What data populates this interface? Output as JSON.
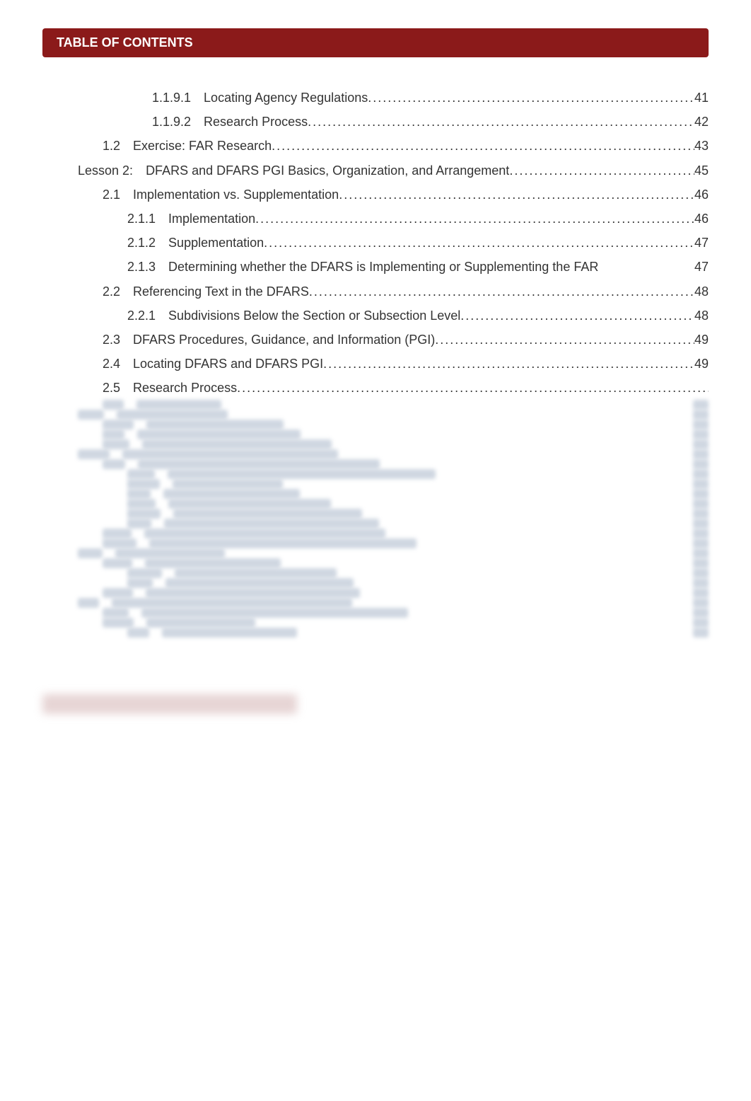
{
  "header": {
    "title": "TABLE OF CONTENTS"
  },
  "toc": [
    {
      "indent": 4,
      "num": "1.1.9.1",
      "title": "Locating Agency Regulations",
      "page": "41",
      "dots": true
    },
    {
      "indent": 4,
      "num": "1.1.9.2",
      "title": "Research Process ",
      "page": "42",
      "dots": true
    },
    {
      "indent": 2,
      "num": "1.2",
      "title": "Exercise: FAR Research ",
      "page": "43",
      "dots": true
    },
    {
      "indent": 1,
      "num": "Lesson 2:",
      "title": "DFARS and DFARS PGI Basics, Organization, and Arrangement ",
      "page": "45",
      "dots": true
    },
    {
      "indent": 2,
      "num": "2.1",
      "title": "Implementation vs. Supplementation",
      "page": "46",
      "dots": true
    },
    {
      "indent": 3,
      "num": "2.1.1",
      "title": "Implementation ",
      "page": "46",
      "dots": true
    },
    {
      "indent": 3,
      "num": "2.1.2",
      "title": "Supplementation",
      "page": "47",
      "dots": true
    },
    {
      "indent": 3,
      "num": "2.1.3",
      "title": "Determining whether the DFARS is Implementing or Supplementing the FAR ",
      "page": "47",
      "dots": false
    },
    {
      "indent": 2,
      "num": "2.2",
      "title": "Referencing Text in the DFARS ",
      "page": "48",
      "dots": true
    },
    {
      "indent": 3,
      "num": "2.2.1",
      "title": "Subdivisions Below the Section or Subsection Level ",
      "page": "48",
      "dots": true
    },
    {
      "indent": 2,
      "num": "2.3",
      "title": "DFARS Procedures, Guidance, and Information (PGI)",
      "page": "49",
      "dots": true
    },
    {
      "indent": 2,
      "num": "2.4",
      "title": "Locating DFARS and DFARS PGI",
      "page": "49",
      "dots": true
    },
    {
      "indent": 2,
      "num": "2.5",
      "title": "Research Process",
      "page": "",
      "dots": true
    }
  ],
  "blurred_rows": 24
}
